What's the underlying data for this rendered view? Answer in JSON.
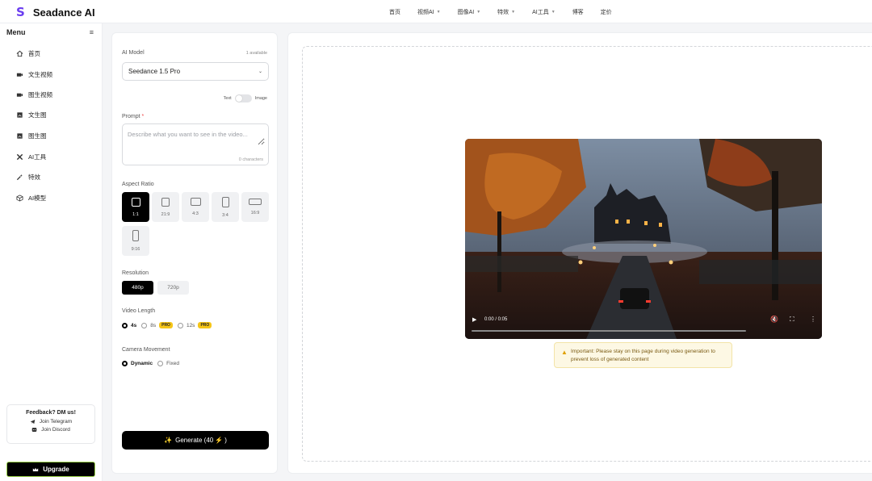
{
  "app": {
    "logo_mark": "S",
    "name": "Seadance AI"
  },
  "nav": [
    {
      "label": "首页",
      "caret": false
    },
    {
      "label": "视频AI",
      "caret": true
    },
    {
      "label": "图像AI",
      "caret": true
    },
    {
      "label": "特效",
      "caret": true
    },
    {
      "label": "AI工具",
      "caret": true
    },
    {
      "label": "博客",
      "caret": false
    },
    {
      "label": "定价",
      "caret": false
    }
  ],
  "sidebar": {
    "title": "Menu",
    "items": [
      {
        "label": "首页",
        "icon": "home-icon"
      },
      {
        "label": "文生视频",
        "icon": "video-icon"
      },
      {
        "label": "图生视频",
        "icon": "image-video-icon"
      },
      {
        "label": "文生图",
        "icon": "text-image-icon"
      },
      {
        "label": "图生图",
        "icon": "image-image-icon"
      },
      {
        "label": "AI工具",
        "icon": "tools-icon"
      },
      {
        "label": "特效",
        "icon": "magic-wand-icon"
      },
      {
        "label": "AI模型",
        "icon": "cube-icon"
      }
    ],
    "feedback": {
      "title": "Feedback? DM us!",
      "telegram": "Join Telegram",
      "discord": "Join Discord"
    },
    "upgrade_label": "Upgrade"
  },
  "form": {
    "model_label": "AI Model",
    "model_available": "1 available",
    "model_value": "Seedance 1.5 Pro",
    "toggle_left": "Text",
    "toggle_right": "Image",
    "prompt_label": "Prompt",
    "prompt_required": "*",
    "prompt_placeholder": "Describe what you want to see in the video...",
    "char_count": "0 characters",
    "aspect_label": "Aspect Ratio",
    "ratios": [
      "1:1",
      "21:9",
      "4:3",
      "3:4",
      "16:9",
      "9:16"
    ],
    "ratio_selected": "1:1",
    "resolution_label": "Resolution",
    "resolutions": [
      "480p",
      "720p"
    ],
    "resolution_selected": "480p",
    "length_label": "Video Length",
    "lengths": [
      {
        "label": "4s",
        "pro": false
      },
      {
        "label": "8s",
        "pro": true
      },
      {
        "label": "12s",
        "pro": true
      }
    ],
    "length_selected": "4s",
    "pro_badge": "PRO",
    "camera_label": "Camera Movement",
    "camera_options": [
      "Dynamic",
      "Fixed"
    ],
    "camera_selected": "Dynamic",
    "generate_label": "Generate (40",
    "generate_suffix": ")"
  },
  "video": {
    "time": "0:00 / 0:05",
    "progress": 0
  },
  "notice": {
    "text": "Important: Please stay on this page during video generation to prevent loss of generated content"
  },
  "colors": {
    "accent": "#6a3cf0",
    "pro": "#f5c518",
    "upgrade_border": "#9bd34a"
  }
}
